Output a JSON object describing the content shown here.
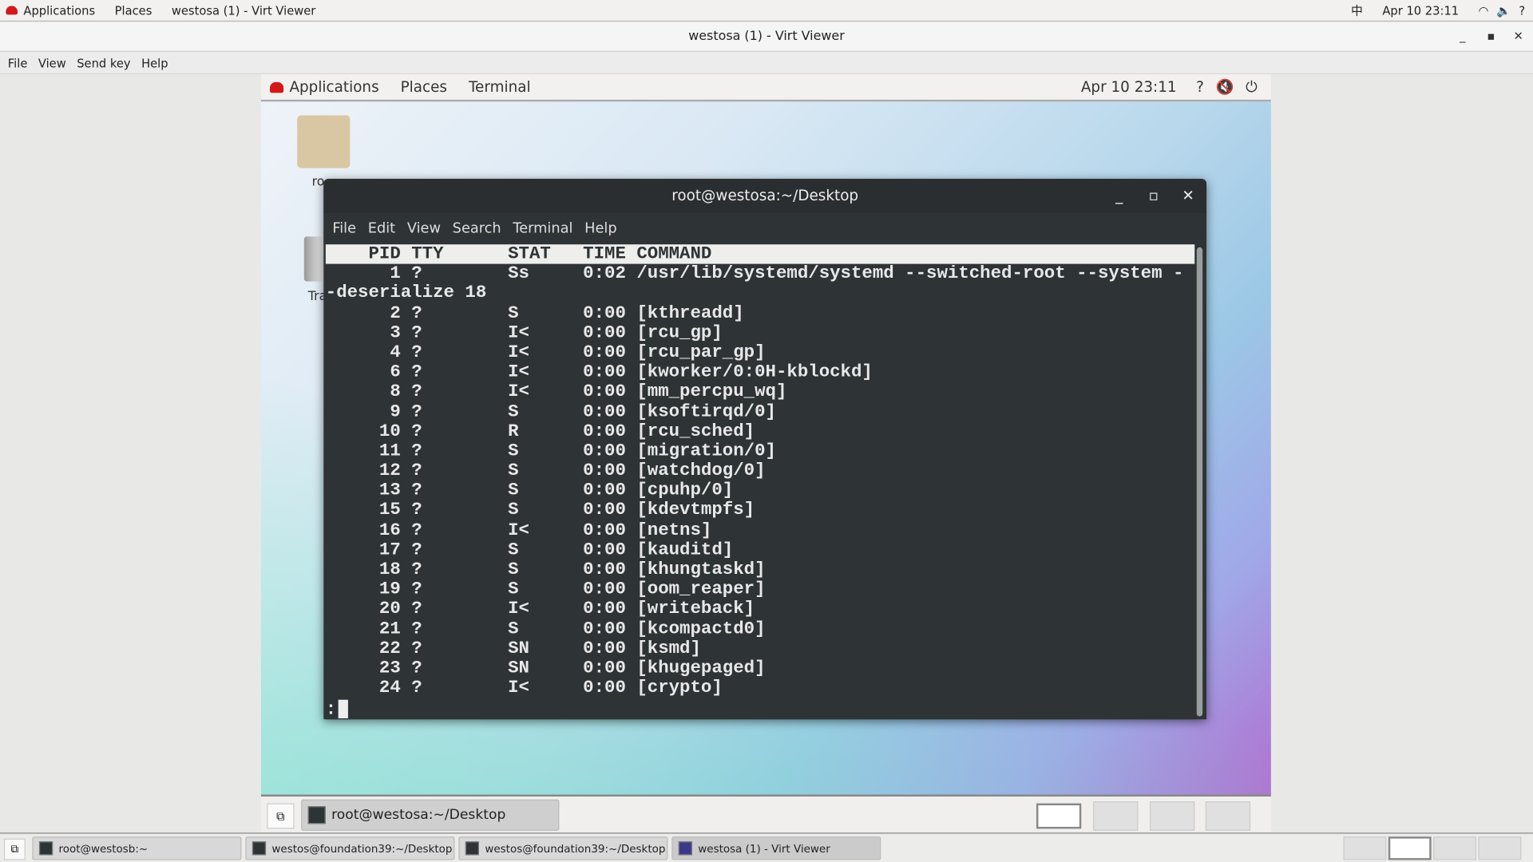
{
  "host_topbar": {
    "applications": "Applications",
    "places": "Places",
    "window": "westosa (1) - Virt Viewer",
    "input_method": "中",
    "clock": "Apr 10  23:11"
  },
  "viewer": {
    "title": "westosa (1) - Virt Viewer",
    "menu": [
      "File",
      "View",
      "Send key",
      "Help"
    ]
  },
  "guest_topbar": {
    "applications": "Applications",
    "places": "Places",
    "terminal": "Terminal",
    "clock": "Apr 10  23:11"
  },
  "desktop": {
    "icons": [
      "ro",
      "Trash"
    ]
  },
  "terminal": {
    "title": "root@westosa:~/Desktop",
    "menu": [
      "File",
      "Edit",
      "View",
      "Search",
      "Terminal",
      "Help"
    ],
    "header": "    PID TTY      STAT   TIME COMMAND",
    "lines": [
      "      1 ?        Ss     0:02 /usr/lib/systemd/systemd --switched-root --system -",
      "-deserialize 18",
      "      2 ?        S      0:00 [kthreadd]",
      "      3 ?        I<     0:00 [rcu_gp]",
      "      4 ?        I<     0:00 [rcu_par_gp]",
      "      6 ?        I<     0:00 [kworker/0:0H-kblockd]",
      "      8 ?        I<     0:00 [mm_percpu_wq]",
      "      9 ?        S      0:00 [ksoftirqd/0]",
      "     10 ?        R      0:00 [rcu_sched]",
      "     11 ?        S      0:00 [migration/0]",
      "     12 ?        S      0:00 [watchdog/0]",
      "     13 ?        S      0:00 [cpuhp/0]",
      "     15 ?        S      0:00 [kdevtmpfs]",
      "     16 ?        I<     0:00 [netns]",
      "     17 ?        S      0:00 [kauditd]",
      "     18 ?        S      0:00 [khungtaskd]",
      "     19 ?        S      0:00 [oom_reaper]",
      "     20 ?        I<     0:00 [writeback]",
      "     21 ?        S      0:00 [kcompactd0]",
      "     22 ?        SN     0:00 [ksmd]",
      "     23 ?        SN     0:00 [khugepaged]",
      "     24 ?        I<     0:00 [crypto]"
    ],
    "prompt": ":"
  },
  "guest_taskbar": {
    "item": "root@westosa:~/Desktop"
  },
  "host_taskbar": {
    "items": [
      "root@westosb:~",
      "westos@foundation39:~/Desktop",
      "westos@foundation39:~/Desktop",
      "westosa (1) - Virt Viewer"
    ]
  }
}
